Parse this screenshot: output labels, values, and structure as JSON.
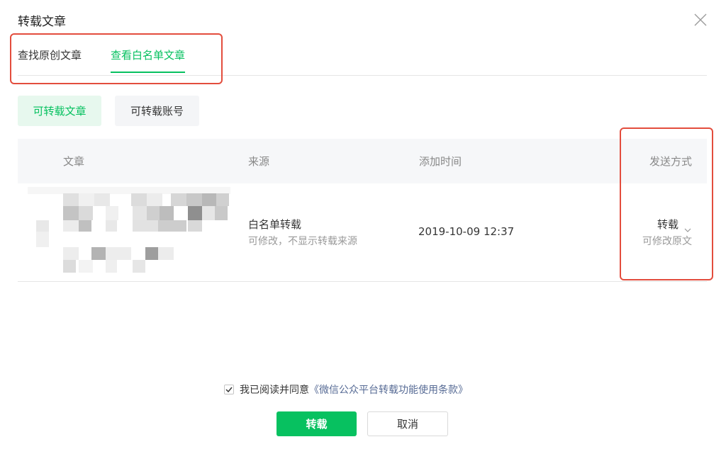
{
  "dialog": {
    "title": "转载文章"
  },
  "tabs": [
    {
      "label": "查找原创文章",
      "active": false
    },
    {
      "label": "查看白名单文章",
      "active": true
    }
  ],
  "filters": [
    {
      "label": "可转载文章",
      "active": true
    },
    {
      "label": "可转载账号",
      "active": false
    }
  ],
  "table": {
    "headers": {
      "article": "文章",
      "source": "来源",
      "time": "添加时间",
      "method": "发送方式"
    },
    "rows": [
      {
        "source_title": "白名单转载",
        "source_desc": "可修改，不显示转载来源",
        "time": "2019-10-09 12:37",
        "method": "转载",
        "method_desc": "可修改原文"
      }
    ]
  },
  "agreement": {
    "checked": true,
    "text": "我已阅读并同意",
    "link": "《微信公众平台转载功能使用条款》"
  },
  "buttons": {
    "confirm": "转载",
    "cancel": "取消"
  },
  "colors": {
    "accent": "#07c160",
    "accent_bg": "#e7f8ee",
    "link": "#576b95",
    "annotation": "#e34d3d",
    "header_bg": "#f6f7f9"
  }
}
